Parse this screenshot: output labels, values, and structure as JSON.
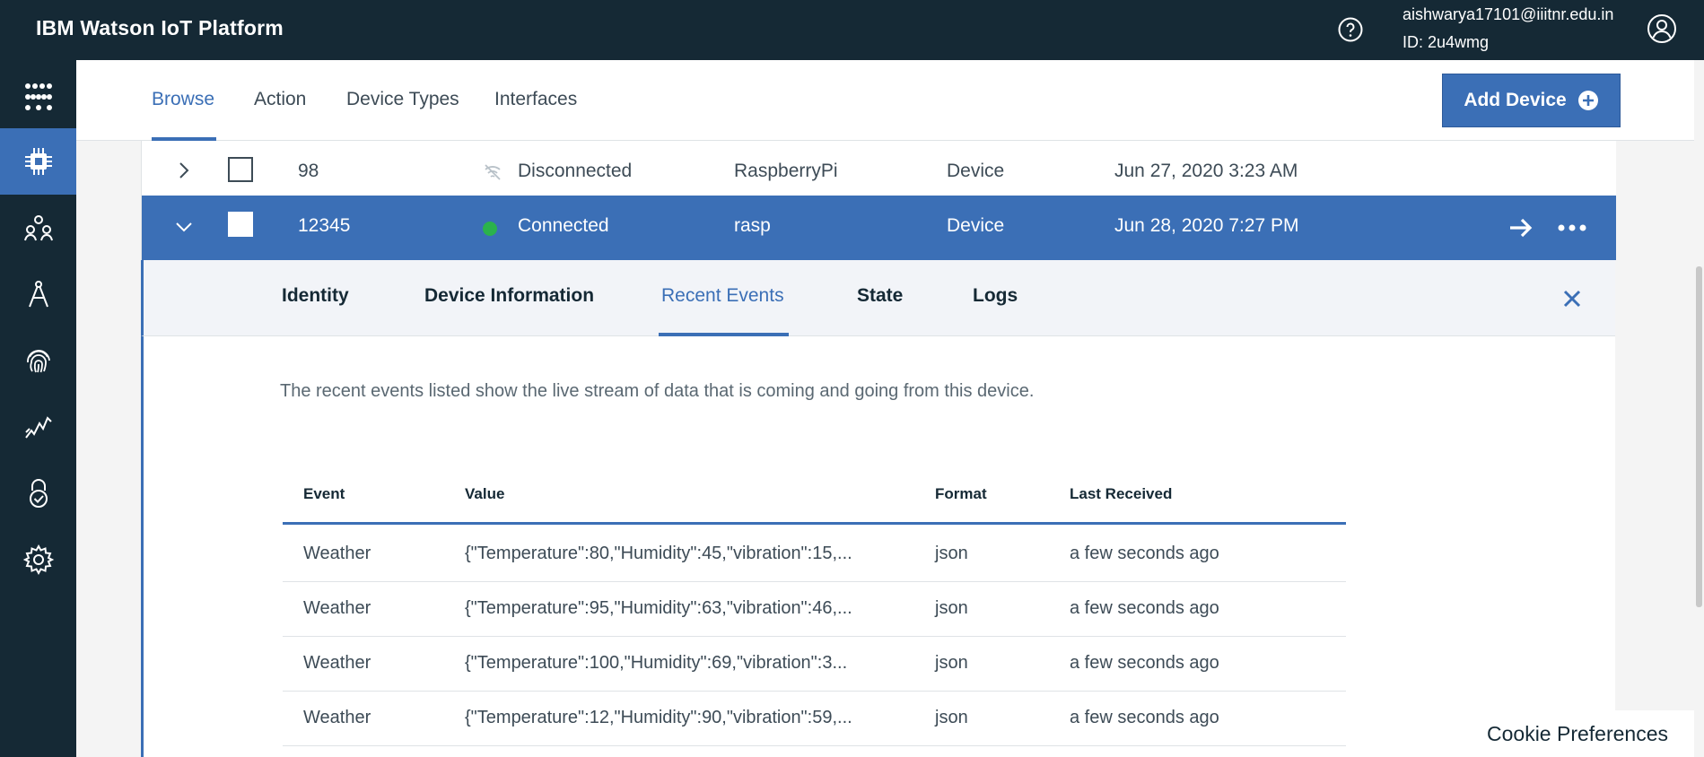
{
  "app": {
    "title": "IBM Watson IoT Platform",
    "user_email": "aishwarya17101@iiitnr.edu.in",
    "org_id": "ID: 2u4wmg"
  },
  "leftnav": {
    "items": [
      "apps-grid-icon",
      "devices-icon",
      "members-icon",
      "rules-icon",
      "security-fingerprint-icon",
      "usage-icon",
      "lock-icon",
      "settings-icon"
    ],
    "active": "devices-icon",
    "accent": "#3b6fb6"
  },
  "tabs": {
    "items": [
      "Browse",
      "Action",
      "Device Types",
      "Interfaces"
    ],
    "active": "Browse",
    "add_device_label": "Add Device"
  },
  "devices": {
    "rows": [
      {
        "id": "98",
        "status": "Disconnected",
        "type": "RaspberryPi",
        "class": "Device",
        "added": "Jun 27, 2020 3:23 AM",
        "expanded": false
      },
      {
        "id": "12345",
        "status": "Connected",
        "type": "rasp",
        "class": "Device",
        "added": "Jun 28, 2020 7:27 PM",
        "expanded": true
      }
    ],
    "status_color_connected": "#2bb24c"
  },
  "detail": {
    "tabs": [
      "Identity",
      "Device Information",
      "Recent Events",
      "State",
      "Logs"
    ],
    "active_tab": "Recent Events",
    "description": "The recent events listed show the live stream of data that is coming and going from this device.",
    "events": {
      "headers": [
        "Event",
        "Value",
        "Format",
        "Last Received"
      ],
      "rows": [
        {
          "event": "Weather",
          "value": "{\"Temperature\":80,\"Humidity\":45,\"vibration\":15,...",
          "format": "json",
          "last": "a few seconds ago"
        },
        {
          "event": "Weather",
          "value": "{\"Temperature\":95,\"Humidity\":63,\"vibration\":46,...",
          "format": "json",
          "last": "a few seconds ago"
        },
        {
          "event": "Weather",
          "value": "{\"Temperature\":100,\"Humidity\":69,\"vibration\":3...",
          "format": "json",
          "last": "a few seconds ago"
        },
        {
          "event": "Weather",
          "value": "{\"Temperature\":12,\"Humidity\":90,\"vibration\":59,...",
          "format": "json",
          "last": "a few seconds ago"
        }
      ]
    }
  },
  "footer": {
    "cookie_label": "Cookie Preferences"
  }
}
